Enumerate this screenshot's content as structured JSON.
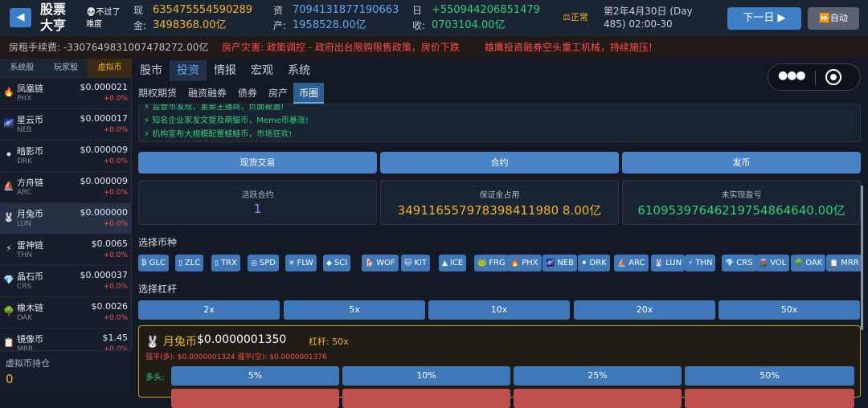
{
  "header": {
    "app_title": "股票大亨",
    "difficulty": "💀不过了难度",
    "cash_label": "现金:",
    "cash_value1": "635475554590289",
    "cash_value2": "3498368.00亿",
    "assets_label": "资产:",
    "assets_value1": "7094131877190663",
    "assets_value2": "1958528.00亿",
    "income_label": "日收:",
    "income_value1": "+550944206851479",
    "income_value2": "0703104.00亿",
    "status": "⚖正常",
    "date": "第2年4月30日 (Day 485) 02:00-30",
    "next_day": "下一日 ▶",
    "auto": "⏩自动"
  },
  "ticker": {
    "fee": "房租手续费: -3307649831007478272.00亿",
    "news1": "房产灾害: 政策调控 - 政府出台限购限售政策，房价下跌",
    "news2": "雄鹰投资融券空头重工机械，持续施压!"
  },
  "sidebar": {
    "tabs": [
      "系统股",
      "玩家股",
      "虚拟币"
    ],
    "coins": [
      {
        "icon": "🔥",
        "name": "凤凰链",
        "sym": "PHX",
        "price": "$0.000021",
        "chg": "+0.0%"
      },
      {
        "icon": "🌌",
        "name": "星云币",
        "sym": "NEB",
        "price": "$0.000017",
        "chg": "+0.0%"
      },
      {
        "icon": "⚫",
        "name": "暗影币",
        "sym": "DRK",
        "price": "$0.000009",
        "chg": "+0.0%"
      },
      {
        "icon": "⛵",
        "name": "方舟链",
        "sym": "ARC",
        "price": "$0.000009",
        "chg": "+0.0%"
      },
      {
        "icon": "🐰",
        "name": "月兔币",
        "sym": "LUN",
        "price": "$0.000000",
        "chg": "+0.0%"
      },
      {
        "icon": "⚡",
        "name": "雷神链",
        "sym": "THN",
        "price": "$0.0065",
        "chg": "+0.0%"
      },
      {
        "icon": "💎",
        "name": "晶石币",
        "sym": "CRS",
        "price": "$0.000037",
        "chg": "+0.0%"
      },
      {
        "icon": "🌳",
        "name": "橡木链",
        "sym": "OAK",
        "price": "$0.0026",
        "chg": "+0.0%"
      },
      {
        "icon": "📋",
        "name": "镜像币",
        "sym": "MRR",
        "price": "$1.45",
        "chg": "+0.0%"
      }
    ],
    "holdings_label": "虚拟币持仓",
    "holdings_value": "0"
  },
  "main": {
    "tabs": [
      "股市",
      "投资",
      "情报",
      "宏观",
      "系统"
    ],
    "subtabs": [
      "期权期货",
      "融资融券",
      "债券",
      "房产",
      "币圈"
    ],
    "news": [
      "⚡ 监管币发现，重要主播商，负面被蛊!",
      "⚡ 知名企业家发文提及萌猫币，Meme币暴涨!",
      "⚡ 机构宣布大规模配置蛙蛙币，市场狂欢!"
    ],
    "actions": [
      "现货交易",
      "合约",
      "发币"
    ],
    "stats": [
      {
        "label": "活跃合约",
        "value": "1"
      },
      {
        "label": "保证金占用",
        "value": "349116557978398411980 8.00亿"
      },
      {
        "label": "未实现盈亏",
        "value": "61095397646219754864640.00亿"
      }
    ],
    "select_coin_label": "选择币种",
    "coin_chips": [
      {
        "icon": "₿",
        "sym": "GLC"
      },
      {
        "icon": "▯",
        "sym": "ZLC"
      },
      {
        "icon": "▯",
        "sym": "TRX"
      },
      {
        "icon": "◎",
        "sym": "SPD"
      },
      {
        "icon": "✕",
        "sym": "FLW"
      },
      {
        "icon": "◆",
        "sym": "SCI"
      },
      {
        "icon": "🐕",
        "sym": "WOF"
      },
      {
        "icon": "🐱",
        "sym": "KIT"
      },
      {
        "icon": "▲",
        "sym": "ICE"
      },
      {
        "icon": "🐸",
        "sym": "FRG"
      },
      {
        "icon": "🔥",
        "sym": "PHX"
      },
      {
        "icon": "🌌",
        "sym": "NEB"
      },
      {
        "icon": "⚫",
        "sym": "DRK"
      },
      {
        "icon": "⛵",
        "sym": "ARC"
      },
      {
        "icon": "🐰",
        "sym": "LUN"
      },
      {
        "icon": "⚡",
        "sym": "THN"
      },
      {
        "icon": "💎",
        "sym": "CRS"
      },
      {
        "icon": "🌋",
        "sym": "VOL"
      },
      {
        "icon": "🌳",
        "sym": "OAK"
      },
      {
        "icon": "📋",
        "sym": "MRR"
      }
    ],
    "select_lev_label": "选择杠杆",
    "leverage": [
      "2x",
      "5x",
      "10x",
      "20x",
      "50x"
    ],
    "trade": {
      "name": "🐰 月兔币",
      "price": "$0.0000001350",
      "lev": "杠杆: 50x",
      "liq": "强平(多): $0.0000001324   强平(空): $0.0000001376",
      "long_label": "多头:",
      "pcts": [
        "5%",
        "10%",
        "25%",
        "50%"
      ]
    }
  }
}
